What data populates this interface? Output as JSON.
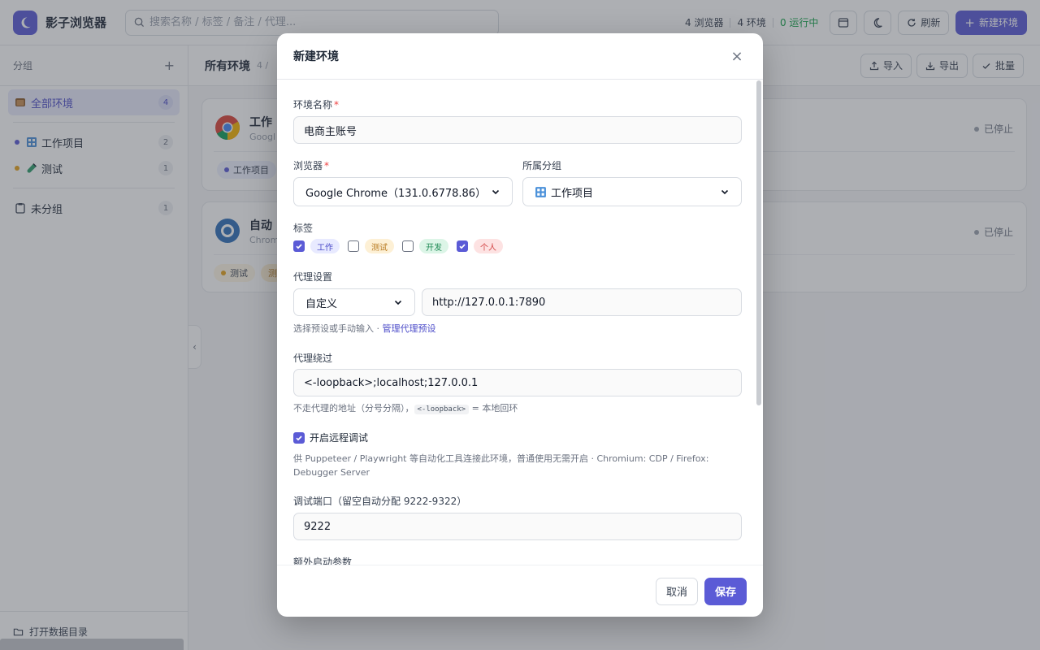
{
  "app": {
    "title": "影子浏览器",
    "search_placeholder": "搜索名称 / 标签 / 备注 / 代理...",
    "stats": {
      "browsers": "4 浏览器",
      "envs": "4 环境",
      "running": "0 运行中"
    },
    "refresh_label": "刷新",
    "new_env_label": "新建环境"
  },
  "sidebar": {
    "header": "分组",
    "add_symbol": "+",
    "items": [
      {
        "label": "全部环境",
        "count": "4"
      },
      {
        "label": "工作项目",
        "count": "2"
      },
      {
        "label": "测试",
        "count": "1"
      },
      {
        "label": "未分组",
        "count": "1"
      }
    ],
    "footer_label": "打开数据目录"
  },
  "main": {
    "title": "所有环境",
    "count": "4 / ",
    "actions": {
      "import": "导入",
      "export": "导出",
      "batch": "批量"
    },
    "cards": [
      {
        "title": "工作",
        "subtitle": "Googl",
        "status": "已停止",
        "chip": "工作项目"
      },
      {
        "title": "自动",
        "subtitle": "Chrom",
        "status": "已停止",
        "chip": "测试",
        "chip2": "测"
      }
    ],
    "collapse_symbol": "‹"
  },
  "colors": {
    "accent": "#5b5bd6",
    "running": "#16a34a",
    "required": "#ef4444"
  },
  "modal": {
    "title": "新建环境",
    "close_symbol": "×",
    "name": {
      "label": "环境名称",
      "required_mark": "*",
      "value": "电商主账号"
    },
    "browser": {
      "label": "浏览器",
      "required_mark": "*",
      "value": "Google Chrome（131.0.6778.86）"
    },
    "group": {
      "label": "所属分组",
      "value": "工作项目"
    },
    "tags": {
      "label": "标签",
      "items": [
        {
          "label": "工作",
          "checked": true
        },
        {
          "label": "测试",
          "checked": false
        },
        {
          "label": "开发",
          "checked": false
        },
        {
          "label": "个人",
          "checked": true
        }
      ]
    },
    "proxy": {
      "label": "代理设置",
      "mode": "自定义",
      "value": "http://127.0.0.1:7890",
      "hint": "选择预设或手动输入 · ",
      "hint_link": "管理代理预设"
    },
    "bypass": {
      "label": "代理绕过",
      "value": "<-loopback>;localhost;127.0.0.1",
      "hint_prefix": "不走代理的地址（分号分隔），",
      "hint_code": "<-loopback>",
      "hint_suffix": " = 本地回环"
    },
    "remote_debug": {
      "label": "开启远程调试",
      "checked": true,
      "hint": "供 Puppeteer / Playwright 等自动化工具连接此环境，普通使用无需开启 · Chromium: CDP / Firefox: Debugger Server"
    },
    "port": {
      "label": "调试端口（留空自动分配 9222-9322）",
      "value": "9222"
    },
    "extra_args_label": "额外启动参数",
    "cancel_label": "取消",
    "save_label": "保存"
  }
}
